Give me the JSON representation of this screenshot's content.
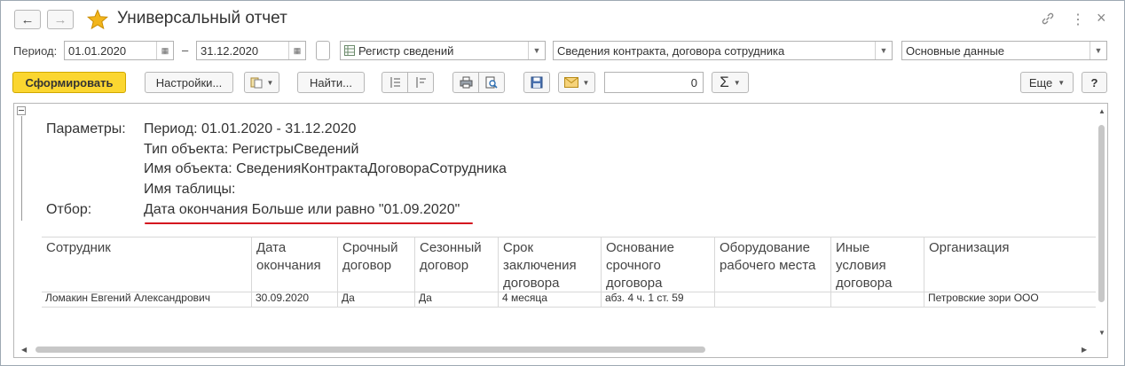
{
  "window": {
    "title": "Универсальный отчет",
    "back_icon": "←",
    "forward_icon": "→",
    "link_icon": "link-icon",
    "more_icon": "⋮",
    "close_icon": "×"
  },
  "params_row": {
    "period_label": "Период:",
    "date_from": "01.01.2020",
    "dash": "–",
    "date_to": "31.12.2020",
    "object_type": "Регистр сведений",
    "object_name": "Сведения контракта, договора сотрудника",
    "table": "Основные данные"
  },
  "toolbar": {
    "generate": "Сформировать",
    "settings": "Настройки...",
    "find": "Найти...",
    "sum_value": "0",
    "more": "Еще",
    "help": "?"
  },
  "report": {
    "params_label": "Параметры:",
    "period_line": "Период: 01.01.2020 - 31.12.2020",
    "object_type_line": "Тип объекта: РегистрыСведений",
    "object_name_line": "Имя объекта: СведенияКонтрактаДоговораСотрудника",
    "table_name_line": "Имя таблицы:",
    "filter_label": "Отбор:",
    "filter_line": "Дата окончания Больше или равно \"01.09.2020\"",
    "columns": [
      "Сотрудник",
      "Дата окончания",
      "Срочный договор",
      "Сезонный договор",
      "Срок заключения договора",
      "Основание срочного договора",
      "Оборудование рабочего места",
      "Иные условия договора",
      "Организация"
    ],
    "rows": [
      [
        "Ломакин Евгений Александрович",
        "30.09.2020",
        "Да",
        "Да",
        "4 месяца",
        "абз. 4 ч. 1 ст. 59",
        "",
        "",
        "Петровские зори ООО"
      ]
    ]
  },
  "colors": {
    "accent_button": "#fbd630",
    "filter_underline": "#d4151f",
    "star": "#f2b51b"
  }
}
